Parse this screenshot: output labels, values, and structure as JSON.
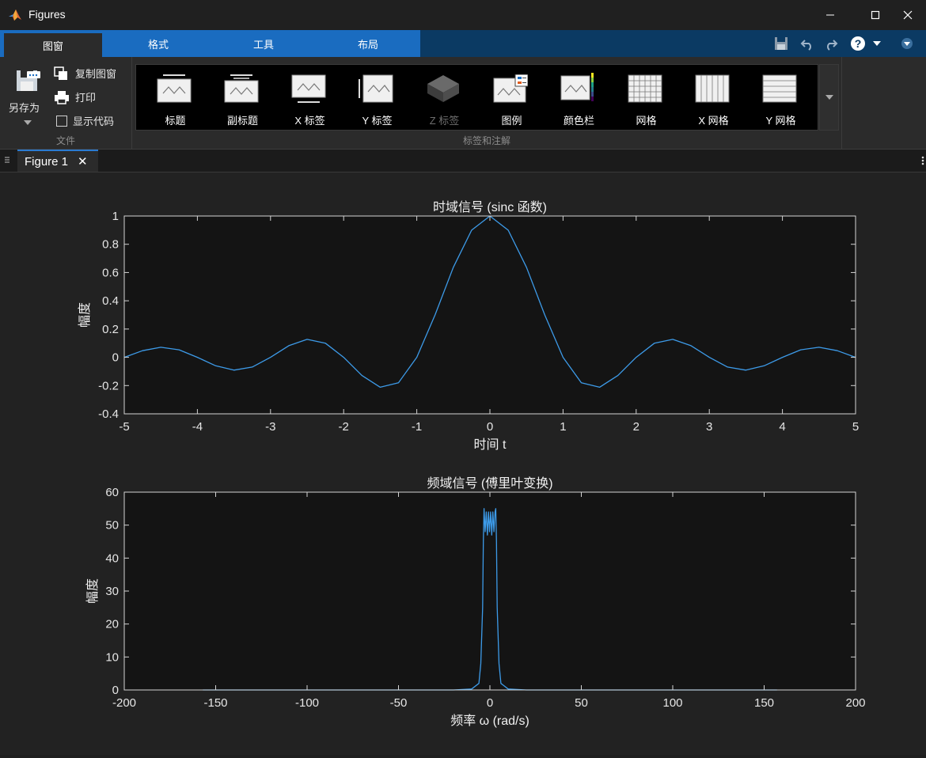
{
  "window": {
    "title": "Figures"
  },
  "ribbon_tabs": [
    {
      "label": "图窗",
      "active": true
    },
    {
      "label": "格式",
      "active": false
    },
    {
      "label": "工具",
      "active": false
    },
    {
      "label": "布局",
      "active": false
    }
  ],
  "file_section": {
    "save_as_label": "另存为",
    "copy_figure_label": "复制图窗",
    "print_label": "打印",
    "show_code_label": "显示代码",
    "show_code_checked": false,
    "section_label": "文件"
  },
  "labels_section": {
    "section_label": "标签和注解",
    "items": [
      {
        "label": "标题",
        "icon": "title-icon",
        "enabled": true
      },
      {
        "label": "副标题",
        "icon": "subtitle-icon",
        "enabled": true
      },
      {
        "label": "X 标签",
        "icon": "xlabel-icon",
        "enabled": true
      },
      {
        "label": "Y 标签",
        "icon": "ylabel-icon",
        "enabled": true
      },
      {
        "label": "Z 标签",
        "icon": "zlabel-icon",
        "enabled": false
      },
      {
        "label": "图例",
        "icon": "legend-icon",
        "enabled": true
      },
      {
        "label": "颜色栏",
        "icon": "colorbar-icon",
        "enabled": true
      },
      {
        "label": "网格",
        "icon": "grid-icon",
        "enabled": true
      },
      {
        "label": "X 网格",
        "icon": "xgrid-icon",
        "enabled": true
      },
      {
        "label": "Y 网格",
        "icon": "ygrid-icon",
        "enabled": true
      }
    ]
  },
  "document_tab": {
    "label": "Figure 1",
    "close_glyph": "✕"
  },
  "colors": {
    "line": "#3d9be9",
    "axes_bg": "#141414",
    "figure_bg": "#222222",
    "accent": "#1a6cc0"
  },
  "chart_data": [
    {
      "type": "line",
      "title": "时域信号 (sinc 函数)",
      "xlabel": "时间 t",
      "ylabel": "幅度",
      "xlim": [
        -5,
        5
      ],
      "ylim": [
        -0.4,
        1
      ],
      "xticks": [
        -5,
        -4,
        -3,
        -2,
        -1,
        0,
        1,
        2,
        3,
        4,
        5
      ],
      "yticks": [
        -0.4,
        -0.2,
        0,
        0.2,
        0.4,
        0.6,
        0.8,
        1
      ],
      "series": [
        {
          "x": [
            -5,
            -4.75,
            -4.5,
            -4.25,
            -4,
            -3.75,
            -3.5,
            -3.25,
            -3,
            -2.75,
            -2.5,
            -2.25,
            -2,
            -1.75,
            -1.5,
            -1.25,
            -1,
            -0.75,
            -0.5,
            -0.25,
            0,
            0.25,
            0.5,
            0.75,
            1,
            1.25,
            1.5,
            1.75,
            2,
            2.25,
            2.5,
            2.75,
            3,
            3.25,
            3.5,
            3.75,
            4,
            4.25,
            4.5,
            4.75,
            5
          ],
          "y": [
            0,
            0.047,
            0.071,
            0.053,
            0,
            -0.06,
            -0.091,
            -0.069,
            0,
            0.082,
            0.127,
            0.1,
            0,
            -0.129,
            -0.212,
            -0.18,
            0,
            0.3,
            0.637,
            0.9,
            1,
            0.9,
            0.637,
            0.3,
            0,
            -0.18,
            -0.212,
            -0.129,
            0,
            0.1,
            0.127,
            0.082,
            0,
            -0.069,
            -0.091,
            -0.06,
            0,
            0.053,
            0.071,
            0.047,
            0
          ]
        }
      ]
    },
    {
      "type": "line",
      "title": "频域信号 (傅里叶变换)",
      "xlabel": "频率 ω (rad/s)",
      "ylabel": "幅度",
      "xlim": [
        -200,
        200
      ],
      "ylim": [
        0,
        60
      ],
      "xticks": [
        -200,
        -150,
        -100,
        -50,
        0,
        50,
        100,
        150,
        200
      ],
      "yticks": [
        0,
        10,
        20,
        30,
        40,
        50,
        60
      ],
      "series": [
        {
          "x": [
            -157,
            -20,
            -10,
            -6,
            -5,
            -4,
            -3.6,
            -3.2,
            -2.6,
            -2,
            -1.4,
            -0.8,
            -0.2,
            0.4,
            1,
            1.6,
            2.2,
            2.8,
            3.2,
            3.6,
            4,
            5,
            6,
            10,
            20,
            157
          ],
          "y": [
            0,
            0,
            0.3,
            2,
            8,
            25,
            45,
            55,
            48,
            54,
            47,
            54,
            48,
            54,
            47,
            54,
            48,
            54,
            55,
            45,
            25,
            8,
            2,
            0.3,
            0,
            0
          ]
        }
      ]
    }
  ]
}
